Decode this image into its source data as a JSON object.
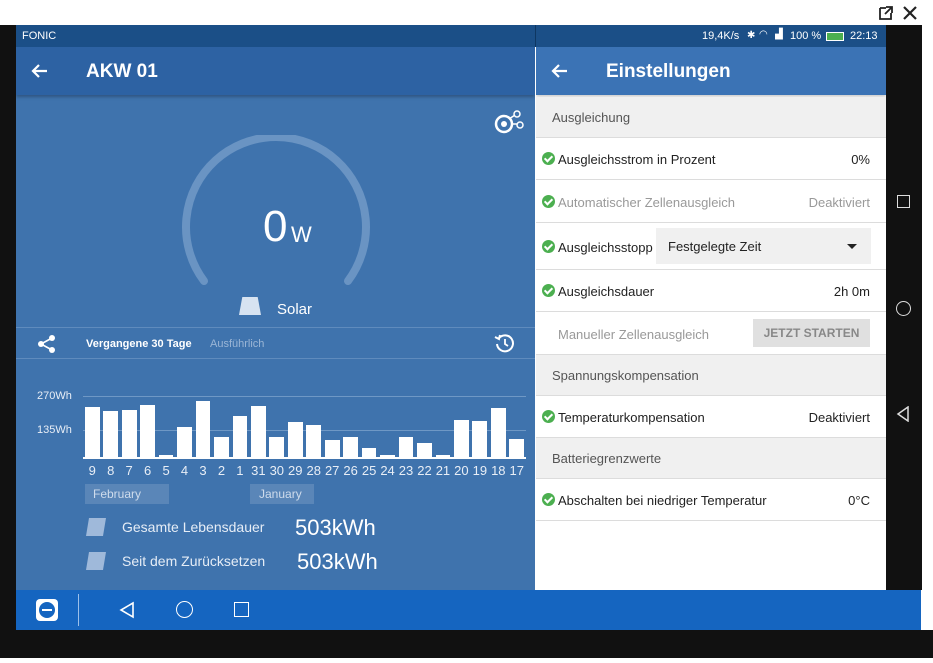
{
  "window": {
    "external_icon": "external-link-icon",
    "close_icon": "close-icon"
  },
  "status": {
    "carrier": "FONIC",
    "speed": "19,4K/s",
    "battery": "100 %",
    "time": "22:13"
  },
  "left": {
    "title": "AKW 01",
    "gauge_value": "0",
    "gauge_unit": "W",
    "source_label": "Solar",
    "tab_active": "Vergangene 30 Tage",
    "tab_inactive": "Ausführlich",
    "y_labels": [
      "270Wh",
      "135Wh"
    ],
    "month_labels": [
      "February",
      "January"
    ],
    "lifetime_label": "Gesamte Lebensdauer",
    "lifetime_value": "503kWh",
    "reset_label": "Seit dem Zurücksetzen",
    "reset_value": "503kWh"
  },
  "chart_data": {
    "type": "bar",
    "categories": [
      "9",
      "8",
      "7",
      "6",
      "5",
      "4",
      "3",
      "2",
      "1",
      "31",
      "30",
      "29",
      "28",
      "27",
      "26",
      "25",
      "24",
      "23",
      "22",
      "21",
      "20",
      "19",
      "18",
      "17"
    ],
    "series": [
      {
        "values": [
          220,
          205,
          210,
          230,
          10,
          135,
          250,
          90,
          180,
          225,
          90,
          155,
          140,
          75,
          90,
          40,
          10,
          90,
          60,
          10,
          165,
          160,
          215,
          80
        ]
      }
    ],
    "y_ticks": [
      135,
      270
    ],
    "ylabel": "",
    "ylim": [
      0,
      290
    ]
  },
  "right": {
    "title": "Einstellungen",
    "sections": {
      "s1": "Ausgleichung",
      "s2": "Spannungskompensation",
      "s3": "Batteriegrenzwerte"
    },
    "rows": {
      "r1_label": "Ausgleichsstrom in Prozent",
      "r1_value": "0%",
      "r2_label": "Automatischer Zellenausgleich",
      "r2_value": "Deaktiviert",
      "r3_label": "Ausgleichsstopp",
      "r3_value": "Festgelegte Zeit",
      "r4_label": "Ausgleichsdauer",
      "r4_value": "2h 0m",
      "r5_label": "Manueller Zellenausgleich",
      "r5_button": "JETZT STARTEN",
      "r6_label": "Temperaturkompensation",
      "r6_value": "Deaktiviert",
      "r7_label": "Abschalten bei niedriger Temperatur",
      "r7_value": "0°C"
    }
  },
  "colors": {
    "accent_blue": "#3b73b5",
    "check_green": "#4caf50",
    "pane_blue": "#3f73ad"
  }
}
